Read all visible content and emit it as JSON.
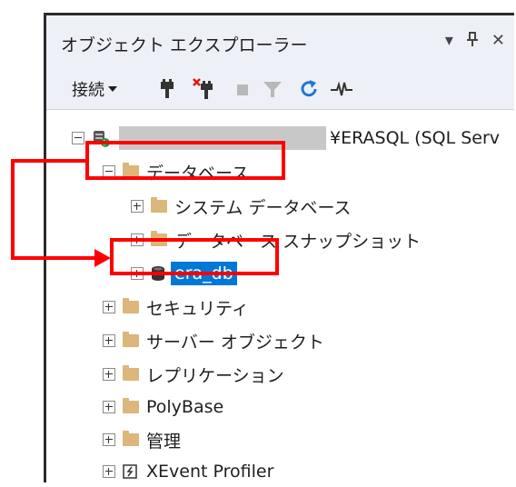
{
  "window": {
    "title": "オブジェクト エクスプローラー",
    "controls": {
      "dropdown": "▾",
      "pin": "🖈",
      "close": "✕"
    }
  },
  "toolbar": {
    "connect_label": "接続"
  },
  "tree": {
    "server": {
      "name_suffix": "¥ERASQL (SQL Serv"
    },
    "databases": {
      "label": "データベース",
      "children": {
        "system_databases": "システム データベース",
        "database_snapshots": "データベース スナップショット",
        "era_db": "era_db"
      }
    },
    "security": "セキュリティ",
    "server_objects": "サーバー オブジェクト",
    "replication": "レプリケーション",
    "polybase": "PolyBase",
    "management": "管理",
    "xevent_profiler": "XEvent Profiler"
  },
  "colors": {
    "highlight": "#ff0000",
    "selection": "#0078d7",
    "folder": "#dcb67a"
  },
  "icons": {
    "connect": "plug-icon",
    "disconnect": "disconnect-icon",
    "stop": "stop-icon",
    "filter": "filter-icon",
    "refresh": "refresh-icon",
    "activity": "activity-monitor-icon"
  }
}
